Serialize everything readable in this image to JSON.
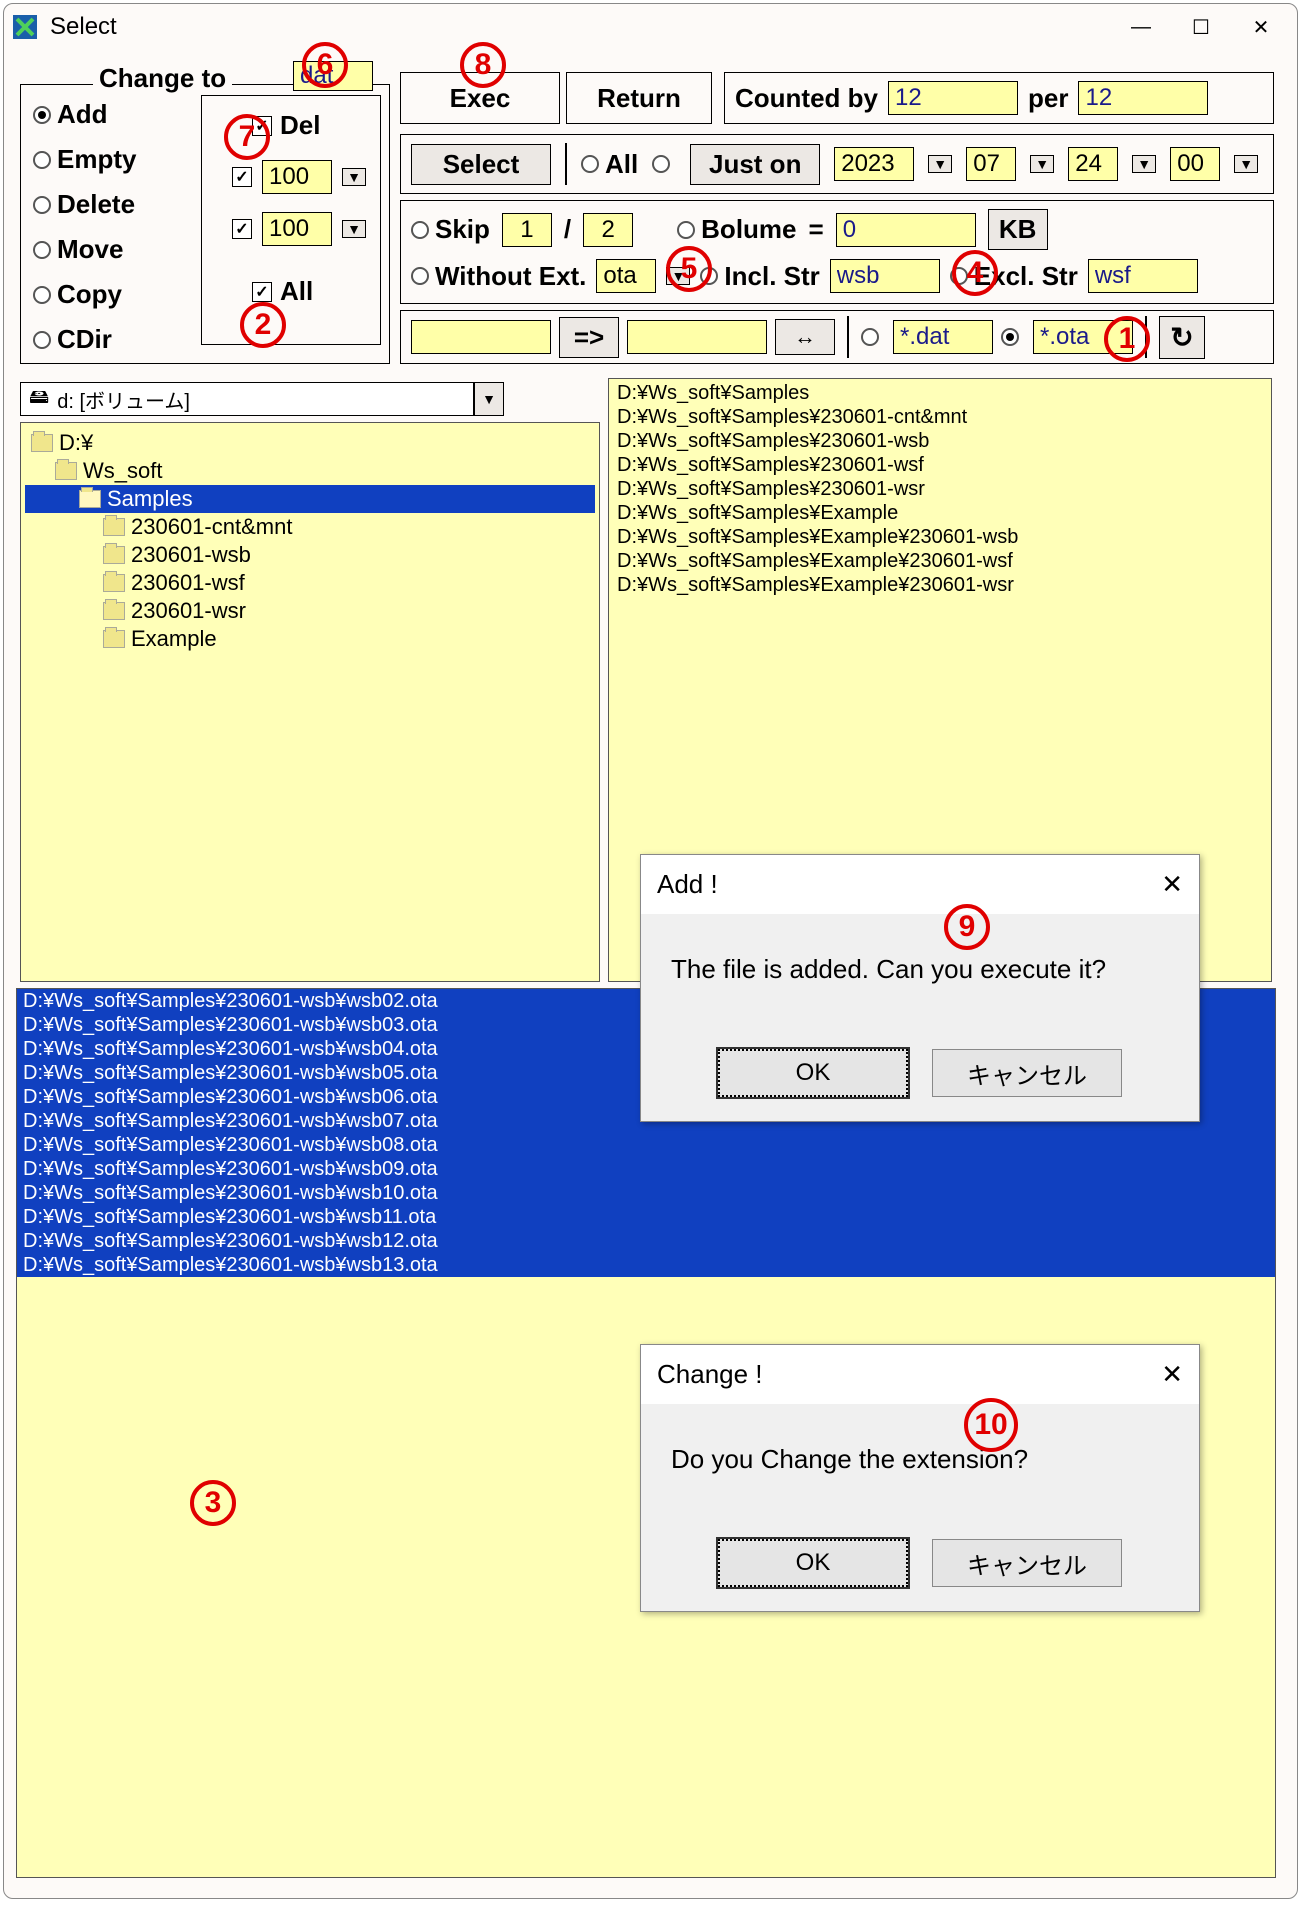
{
  "window": {
    "title": "Select"
  },
  "change_to": {
    "label": "Change to",
    "value": "dat"
  },
  "radios": {
    "add": "Add",
    "empty": "Empty",
    "delete": "Delete",
    "move": "Move",
    "copy": "Copy",
    "cdir": "CDir",
    "selected": "add"
  },
  "del_check": {
    "label": "Del",
    "checked": true
  },
  "spin1": {
    "value": "100",
    "checked": true
  },
  "spin2": {
    "value": "100",
    "checked": true
  },
  "all_check": {
    "label": "All",
    "checked": true
  },
  "top_buttons": {
    "exec": "Exec",
    "return": "Return"
  },
  "counted": {
    "label": "Counted by",
    "v1": "12",
    "per": "per",
    "v2": "12"
  },
  "select_row": {
    "select": "Select",
    "all": "All",
    "just_on": "Just on",
    "y": "2023",
    "m": "07",
    "d": "24",
    "h": "00"
  },
  "skip_row": {
    "skip": "Skip",
    "a": "1",
    "b": "2",
    "bolume": "Bolume",
    "eq": "=",
    "bol_val": "0",
    "kb": "KB"
  },
  "str_row": {
    "without_ext": "Without Ext.",
    "ext_val": "ota",
    "incl": "Incl. Str",
    "incl_val": "wsb",
    "excl": "Excl. Str",
    "excl_val": "wsf"
  },
  "filter_row": {
    "arrow": "=>",
    "both": "↔",
    "opt1": "*.dat",
    "opt2": "*.ota",
    "selected": "opt2",
    "refresh": "↻"
  },
  "drive": "d: [ボリューム]",
  "tree": [
    {
      "name": "D:¥",
      "indent": 0
    },
    {
      "name": "Ws_soft",
      "indent": 1
    },
    {
      "name": "Samples",
      "indent": 2,
      "selected": true,
      "open": true
    },
    {
      "name": "230601-cnt&mnt",
      "indent": 3
    },
    {
      "name": "230601-wsb",
      "indent": 3
    },
    {
      "name": "230601-wsf",
      "indent": 3
    },
    {
      "name": "230601-wsr",
      "indent": 3
    },
    {
      "name": "Example",
      "indent": 3
    }
  ],
  "paths": [
    "D:¥Ws_soft¥Samples",
    "D:¥Ws_soft¥Samples¥230601-cnt&mnt",
    "D:¥Ws_soft¥Samples¥230601-wsb",
    "D:¥Ws_soft¥Samples¥230601-wsf",
    "D:¥Ws_soft¥Samples¥230601-wsr",
    "D:¥Ws_soft¥Samples¥Example",
    "D:¥Ws_soft¥Samples¥Example¥230601-wsb",
    "D:¥Ws_soft¥Samples¥Example¥230601-wsf",
    "D:¥Ws_soft¥Samples¥Example¥230601-wsr"
  ],
  "file_list": [
    "D:¥Ws_soft¥Samples¥230601-wsb¥wsb02.ota",
    "D:¥Ws_soft¥Samples¥230601-wsb¥wsb03.ota",
    "D:¥Ws_soft¥Samples¥230601-wsb¥wsb04.ota",
    "D:¥Ws_soft¥Samples¥230601-wsb¥wsb05.ota",
    "D:¥Ws_soft¥Samples¥230601-wsb¥wsb06.ota",
    "D:¥Ws_soft¥Samples¥230601-wsb¥wsb07.ota",
    "D:¥Ws_soft¥Samples¥230601-wsb¥wsb08.ota",
    "D:¥Ws_soft¥Samples¥230601-wsb¥wsb09.ota",
    "D:¥Ws_soft¥Samples¥230601-wsb¥wsb10.ota",
    "D:¥Ws_soft¥Samples¥230601-wsb¥wsb11.ota",
    "D:¥Ws_soft¥Samples¥230601-wsb¥wsb12.ota",
    "D:¥Ws_soft¥Samples¥230601-wsb¥wsb13.ota"
  ],
  "dialog_add": {
    "title": "Add !",
    "body": "The file is added. Can you execute it?",
    "ok": "OK",
    "cancel": "キャンセル"
  },
  "dialog_change": {
    "title": "Change !",
    "body": "Do you Change the extension?",
    "ok": "OK",
    "cancel": "キャンセル"
  },
  "annotations": {
    "n1": "1",
    "n2": "2",
    "n3": "3",
    "n4": "4",
    "n5": "5",
    "n6": "6",
    "n7": "7",
    "n8": "8",
    "n9": "9",
    "n10": "10"
  }
}
